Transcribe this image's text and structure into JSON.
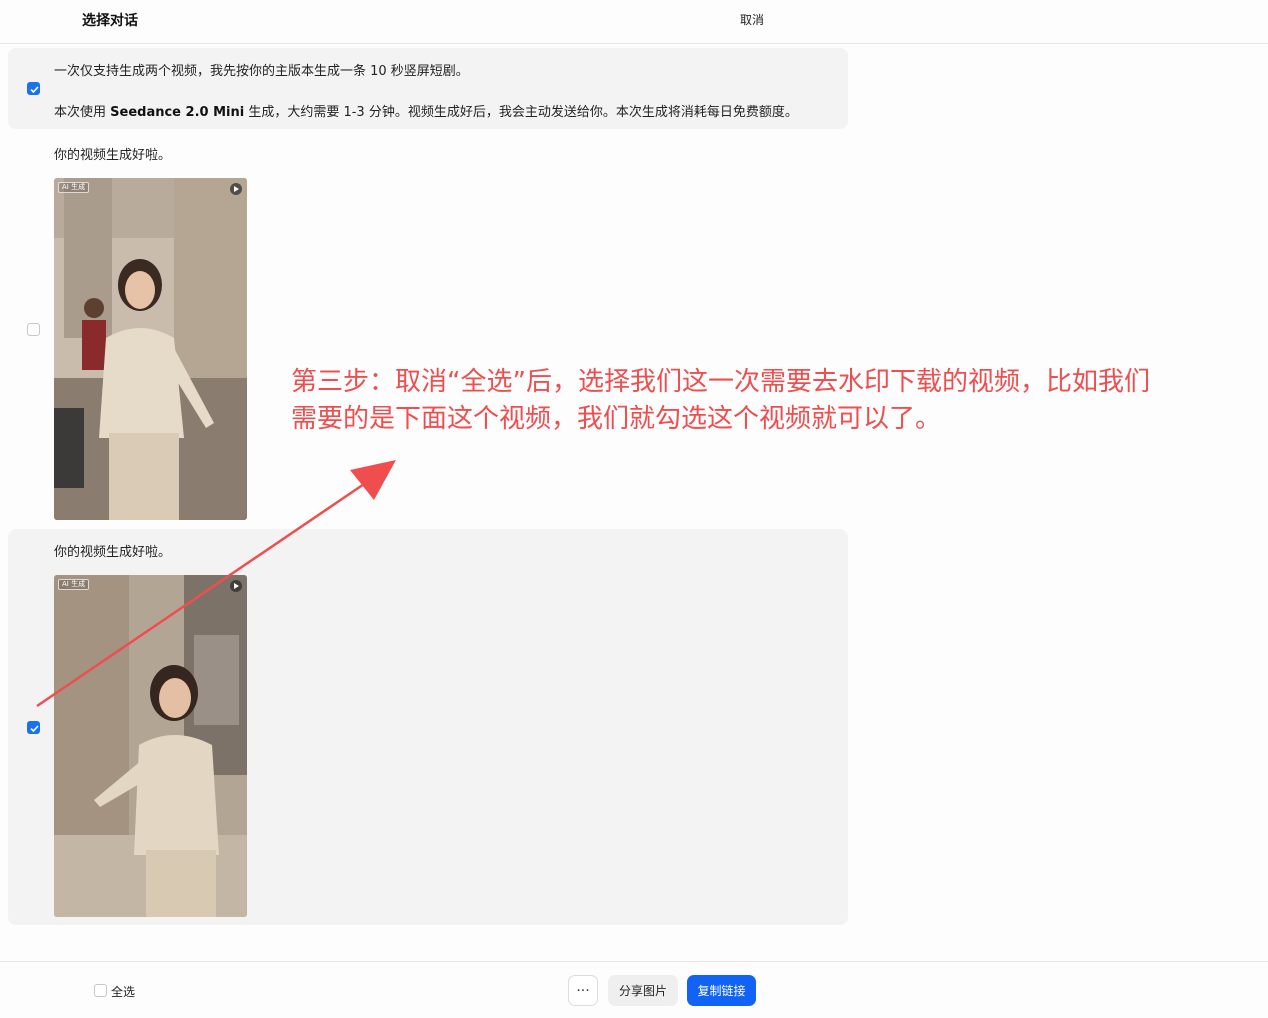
{
  "header": {
    "title": "选择对话",
    "cancel_label": "取消"
  },
  "messages": [
    {
      "line1": "一次仅支持生成两个视频，我先按你的主版本生成一条 10 秒竖屏短剧。",
      "line2_prefix": "本次使用 ",
      "line2_bold": "Seedance 2.0 Mini",
      "line2_suffix": " 生成，大约需要 1-3 分钟。视频生成好后，我会主动发送给你。本次生成将消耗每日免费额度。",
      "checked": true
    },
    {
      "text": "你的视频生成好啦。",
      "video_tag": "AI 生成",
      "checked": false
    },
    {
      "text": "你的视频生成好啦。",
      "video_tag": "AI 生成",
      "checked": true
    }
  ],
  "annotation": {
    "text": "第三步：取消“全选”后，选择我们这一次需要去水印下载的视频，比如我们需要的是下面这个视频，我们就勾选这个视频就可以了。",
    "color": "#f04e4e"
  },
  "footer": {
    "select_all_label": "全选",
    "more_label": "···",
    "share_label": "分享图片",
    "copy_label": "复制链接"
  },
  "colors": {
    "accent": "#1163f5",
    "checkbox": "#1a73e8",
    "selected_bg": "#f3f3f3"
  },
  "icons": [
    "checkmark-icon",
    "play-icon",
    "more-icon"
  ]
}
